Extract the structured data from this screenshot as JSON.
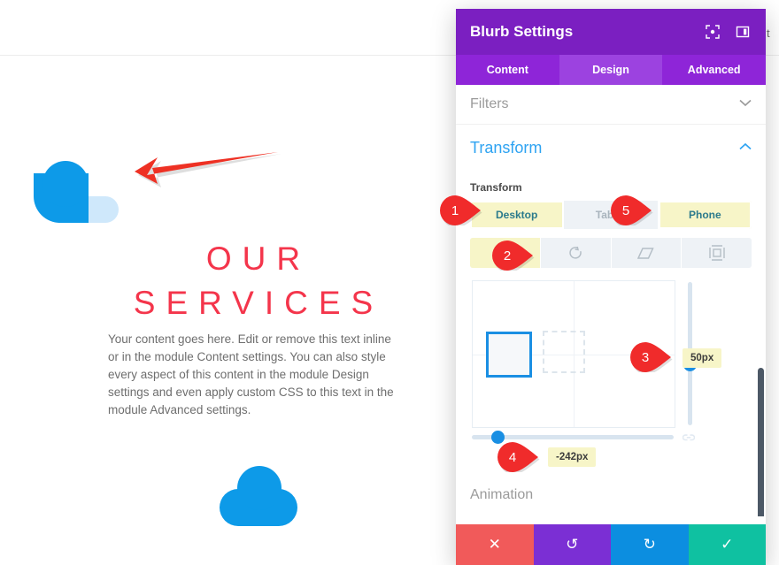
{
  "website": {
    "blurb_title": "OUR SERVICES",
    "blurb_body": "Your content goes here. Edit or remove this text inline or in the module Content settings. You can also style every aspect of this content in the module Design settings and even apply custom CSS to this text in the module Advanced settings.",
    "logo_icon": "cloud-icon",
    "deco_icon": "cloud-icon",
    "arrow_icon": "left-arrow-annotation-icon",
    "edge_text": "t",
    "accent_color": "#f4354b",
    "cloud_color": "#0d9ae8"
  },
  "modal": {
    "title": "Blurb Settings",
    "header_icons": [
      {
        "name": "focus-mode-icon",
        "glyph": "⬚"
      },
      {
        "name": "layout-view-icon",
        "glyph": "◫"
      }
    ],
    "tabs": [
      {
        "label": "Content",
        "active": false
      },
      {
        "label": "Design",
        "active": true
      },
      {
        "label": "Advanced",
        "active": false
      }
    ],
    "sections": {
      "filters": {
        "label": "Filters",
        "state": "collapsed",
        "chevron": "⌄"
      },
      "transform": {
        "label": "Transform",
        "state": "expanded",
        "chevron": "⌃"
      },
      "animation": {
        "label": "Animation",
        "state": "collapsed"
      }
    },
    "transform": {
      "field_label": "Transform",
      "devices": [
        {
          "label": "Desktop",
          "highlighted": true
        },
        {
          "label": "Tablet",
          "highlighted": false
        },
        {
          "label": "Phone",
          "highlighted": true
        }
      ],
      "modes": [
        {
          "name": "translate-icon",
          "active": true
        },
        {
          "name": "rotate-icon",
          "active": false
        },
        {
          "name": "skew-icon",
          "active": false
        },
        {
          "name": "scale-icon",
          "active": false
        }
      ],
      "vertical_value": "50px",
      "horizontal_value": "-242px",
      "link_icon": "link-axes-icon"
    },
    "footer": [
      {
        "name": "discard-button",
        "glyph": "✕",
        "color": "#f15a5a"
      },
      {
        "name": "undo-button",
        "glyph": "↺",
        "color": "#7b2fd4"
      },
      {
        "name": "redo-button",
        "glyph": "↻",
        "color": "#0c8ee0"
      },
      {
        "name": "save-button",
        "glyph": "✓",
        "color": "#0fc1a1"
      }
    ]
  },
  "callouts": [
    {
      "number": "1",
      "target": "desktop-device-button"
    },
    {
      "number": "2",
      "target": "translate-mode-button"
    },
    {
      "number": "3",
      "target": "vertical-slider-handle"
    },
    {
      "number": "4",
      "target": "horizontal-slider-handle"
    },
    {
      "number": "5",
      "target": "phone-device-button"
    }
  ]
}
